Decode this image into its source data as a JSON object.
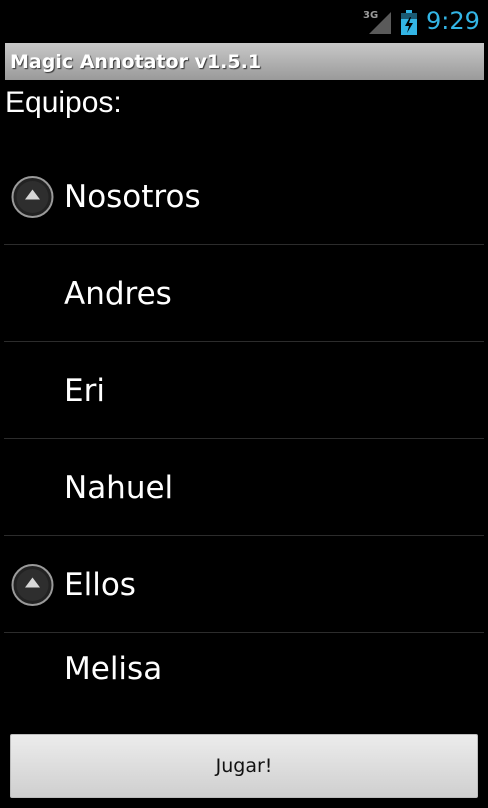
{
  "status_bar": {
    "network": "3G",
    "signal_icon": "signal-icon",
    "battery_icon": "battery-charging-icon",
    "time": "9:29",
    "time_color": "#33b5e5"
  },
  "app": {
    "title": "Magic Annotator v1.5.1"
  },
  "main": {
    "section_label": "Equipos:",
    "teams": [
      {
        "name": "Nosotros",
        "expanded": true,
        "members": [
          "Andres",
          "Eri",
          "Nahuel"
        ]
      },
      {
        "name": "Ellos",
        "expanded": true,
        "members": [
          "Melisa"
        ]
      }
    ]
  },
  "actions": {
    "play_label": "Jugar!"
  }
}
